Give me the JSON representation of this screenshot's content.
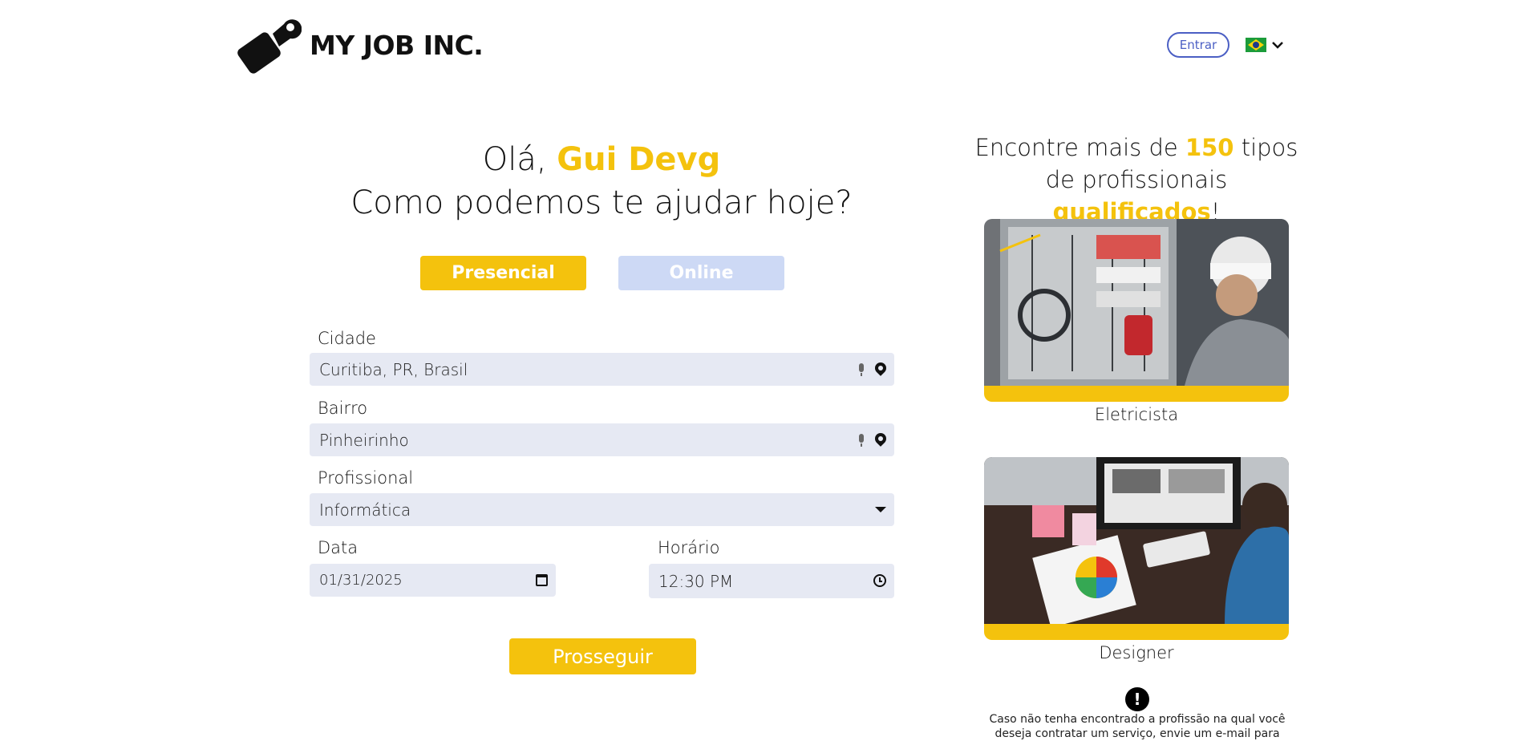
{
  "header": {
    "brand": "MY JOB INC.",
    "login_label": "Entrar",
    "language_flag": "brazil-flag-icon",
    "language_chevron": "chevron-down-icon"
  },
  "greeting": {
    "hello": "Olá,",
    "user_name": "Gui Devg",
    "question": "Como podemos te ajudar hoje?"
  },
  "mode_tabs": [
    {
      "label": "Presencial",
      "active": true,
      "color": "#f4c20d"
    },
    {
      "label": "Online",
      "active": false,
      "color": "#cdd9f5"
    }
  ],
  "form": {
    "city": {
      "label": "Cidade",
      "value": "Curitiba, PR, Brasil"
    },
    "district": {
      "label": "Bairro",
      "value": "Pinheirinho"
    },
    "professional": {
      "label": "Profissional",
      "value": "Informática"
    },
    "date": {
      "label": "Data",
      "value": "01/31/2025"
    },
    "time": {
      "label": "Horário",
      "value": "12:30 PM"
    },
    "submit_label": "Prosseguir"
  },
  "promo": {
    "line1_pre": "Encontre mais de",
    "count": "150",
    "line1_post": "tipos",
    "line2_pre": "de profissionais",
    "highlight": "qualificados",
    "line2_post": "!"
  },
  "cards": [
    {
      "label": "Eletricista"
    },
    {
      "label": "Designer"
    }
  ],
  "notice": {
    "icon": "exclamation-icon",
    "text": "Caso não tenha encontrado a profissão na qual você deseja contratar um serviço, envie um e-mail para"
  },
  "colors": {
    "accent": "#f4c20d",
    "field_bg": "#e6e9f3",
    "login_border": "#4b5fc4",
    "online_tab": "#cdd9f5"
  }
}
